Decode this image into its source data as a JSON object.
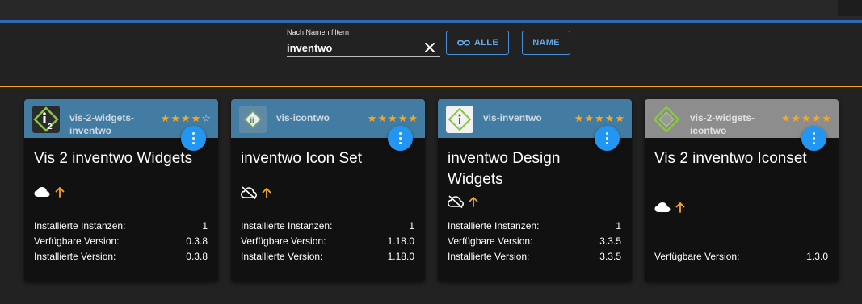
{
  "filter": {
    "label": "Nach Namen filtern",
    "value": "inventwo"
  },
  "buttons": {
    "all_label": "ALLE",
    "name_label": "NAME"
  },
  "colors": {
    "accent": "#2196f3",
    "header_blue": "#437ca3",
    "header_gray": "#8d8d8d",
    "star": "#f5a623",
    "divider": "#f5a623"
  },
  "cards": [
    {
      "adapter_name": "vis-2-widgets-inventwo",
      "rating": 4,
      "title": "Vis 2 inventwo Widgets",
      "cloud": "cloud-icon",
      "installed_instances_label": "Installierte Instanzen:",
      "installed_instances": "1",
      "available_version_label": "Verfügbare Version:",
      "available_version": "0.3.8",
      "installed_version_label": "Installierte Version:",
      "installed_version": "0.3.8"
    },
    {
      "adapter_name": "vis-icontwo",
      "rating": 5,
      "title": "inventwo Icon Set",
      "cloud": "cloud-off-icon",
      "installed_instances_label": "Installierte Instanzen:",
      "installed_instances": "1",
      "available_version_label": "Verfügbare Version:",
      "available_version": "1.18.0",
      "installed_version_label": "Installierte Version:",
      "installed_version": "1.18.0"
    },
    {
      "adapter_name": "vis-inventwo",
      "rating": 5,
      "title": "inventwo Design Widgets",
      "cloud": "cloud-off-icon",
      "installed_instances_label": "Installierte Instanzen:",
      "installed_instances": "1",
      "available_version_label": "Verfügbare Version:",
      "available_version": "3.3.5",
      "installed_version_label": "Installierte Version:",
      "installed_version": "3.3.5"
    },
    {
      "adapter_name": "vis-2-widgets-icontwo",
      "rating": 5,
      "title": "Vis 2 inventwo Iconset",
      "cloud": "cloud-icon",
      "available_version_label": "Verfügbare Version:",
      "available_version": "1.3.0"
    }
  ]
}
